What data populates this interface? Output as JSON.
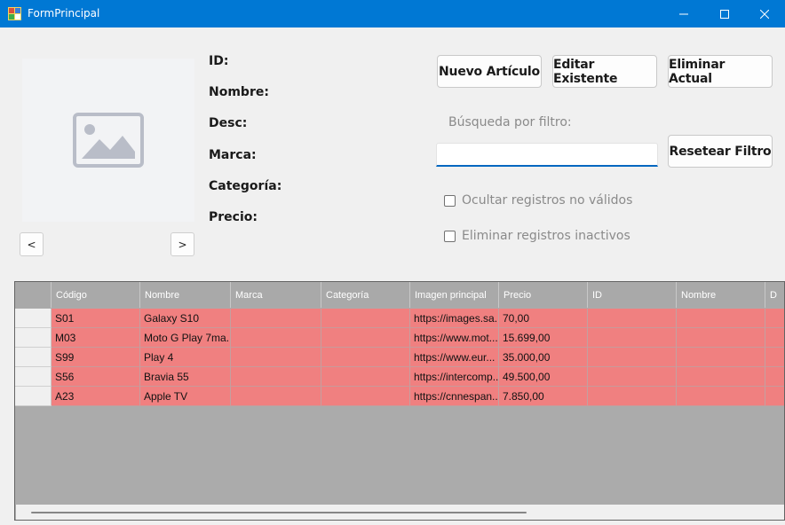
{
  "window": {
    "title": "FormPrincipal",
    "accent": "#0078d4"
  },
  "picture": {
    "icon": "image-placeholder-icon"
  },
  "nav": {
    "prev_label": "<",
    "next_label": ">"
  },
  "fields": {
    "id_label": "ID:",
    "nombre_label": "Nombre:",
    "desc_label": "Desc:",
    "marca_label": "Marca:",
    "categoria_label": "Categoría:",
    "precio_label": "Precio:"
  },
  "toolbar": {
    "nuevo_label": "Nuevo Artículo",
    "editar_label": "Editar Existente",
    "eliminar_label": "Eliminar Actual",
    "resetear_label": "Resetear Filtro"
  },
  "filter": {
    "label": "Búsqueda por filtro:",
    "value": ""
  },
  "options": {
    "ocultar_label": "Ocultar registros no válidos",
    "ocultar_checked": false,
    "eliminar_inactivos_label": "Eliminar registros inactivos",
    "eliminar_inactivos_checked": false
  },
  "grid": {
    "row_color": "#f08080",
    "columns": [
      "Código",
      "Nombre",
      "Marca",
      "Categoría",
      "Imagen principal",
      "Precio",
      "ID",
      "Nombre",
      "D"
    ],
    "rows": [
      [
        "S01",
        "Galaxy S10",
        "",
        "",
        "https://images.sa...",
        "70,00",
        "",
        "",
        ""
      ],
      [
        "M03",
        "Moto G Play 7ma...",
        "",
        "",
        "https://www.mot...",
        "15.699,00",
        "",
        "",
        ""
      ],
      [
        "S99",
        "Play 4",
        "",
        "",
        "https://www.eur...",
        "35.000,00",
        "",
        "",
        ""
      ],
      [
        "S56",
        "Bravia 55",
        "",
        "",
        "https://intercomp...",
        "49.500,00",
        "",
        "",
        ""
      ],
      [
        "A23",
        "Apple TV",
        "",
        "",
        "https://cnnespan...",
        "7.850,00",
        "",
        "",
        ""
      ]
    ]
  }
}
